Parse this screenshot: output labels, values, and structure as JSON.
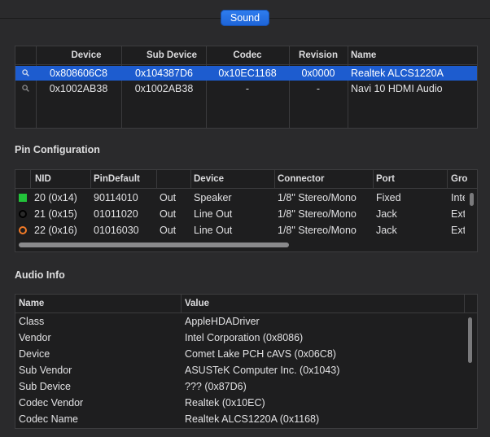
{
  "tab": {
    "label": "Sound"
  },
  "devices": {
    "headers": [
      "Device",
      "Sub Device",
      "Codec",
      "Revision",
      "Name"
    ],
    "rows": [
      {
        "device": "0x808606C8",
        "sub_device": "0x104387D6",
        "codec": "0x10EC1168",
        "revision": "0x0000",
        "name": "Realtek ALCS1220A",
        "selected": true
      },
      {
        "device": "0x1002AB38",
        "sub_device": "0x1002AB38",
        "codec": "-",
        "revision": "-",
        "name": "Navi 10 HDMI Audio",
        "selected": false
      }
    ]
  },
  "pin": {
    "title": "Pin Configuration",
    "headers": [
      "NID",
      "PinDefault",
      "",
      "Device",
      "Connector",
      "Port",
      "Gro"
    ],
    "rows": [
      {
        "color": "#22c33a",
        "shape": "square",
        "nid": "20 (0x14)",
        "pindefault": "90114010",
        "dir": "Out",
        "device": "Speaker",
        "connector": "1/8\" Stereo/Mono",
        "port": "Fixed",
        "group": "Inte"
      },
      {
        "color": "#111111",
        "shape": "ring",
        "nid": "21 (0x15)",
        "pindefault": "01011020",
        "dir": "Out",
        "device": "Line Out",
        "connector": "1/8\" Stereo/Mono",
        "port": "Jack",
        "group": "Ext"
      },
      {
        "color": "#f27a27",
        "shape": "ring",
        "nid": "22 (0x16)",
        "pindefault": "01016030",
        "dir": "Out",
        "device": "Line Out",
        "connector": "1/8\" Stereo/Mono",
        "port": "Jack",
        "group": "Ext"
      }
    ]
  },
  "audio": {
    "title": "Audio Info",
    "headers": [
      "Name",
      "Value"
    ],
    "rows": [
      {
        "name": "Class",
        "value": "AppleHDADriver"
      },
      {
        "name": "Vendor",
        "value": "Intel Corporation (0x8086)"
      },
      {
        "name": "Device",
        "value": "Comet Lake PCH cAVS (0x06C8)"
      },
      {
        "name": "Sub Vendor",
        "value": "ASUSTeK Computer Inc. (0x1043)"
      },
      {
        "name": "Sub Device",
        "value": "??? (0x87D6)"
      },
      {
        "name": "Codec Vendor",
        "value": "Realtek (0x10EC)"
      },
      {
        "name": "Codec Name",
        "value": "Realtek ALCS1220A (0x1168)"
      }
    ]
  },
  "colors": {
    "accent": "#1d5ccf",
    "background": "#2a2a2c",
    "table": "#1e1e1f"
  }
}
